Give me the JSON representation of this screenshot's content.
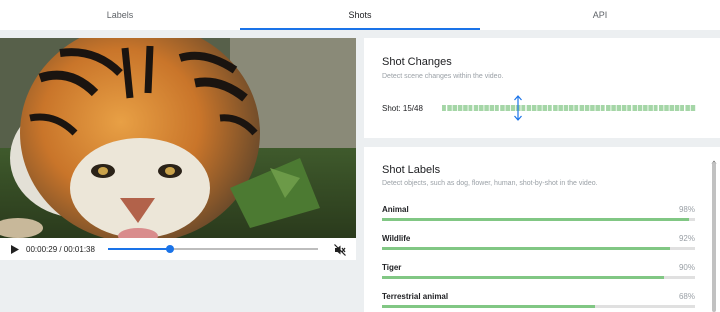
{
  "tabs": [
    {
      "label": "Labels",
      "active": false
    },
    {
      "label": "Shots",
      "active": true
    },
    {
      "label": "API",
      "active": false
    }
  ],
  "player": {
    "time": "00:00:29 / 00:01:38",
    "progress_fraction": 0.296,
    "play_icon": "play-icon",
    "mute_icon": "volume-off-icon"
  },
  "shot_changes": {
    "title": "Shot Changes",
    "subtitle": "Detect scene changes within the video.",
    "shot_label": "Shot: 15/48",
    "current_shot": 15,
    "total_shots": 48
  },
  "shot_labels": {
    "title": "Shot Labels",
    "subtitle": "Detect objects, such as dog, flower, human, shot-by-shot in the video.",
    "items": [
      {
        "name": "Animal",
        "percent": "98%",
        "value": 0.98
      },
      {
        "name": "Wildlife",
        "percent": "92%",
        "value": 0.92
      },
      {
        "name": "Tiger",
        "percent": "90%",
        "value": 0.9
      },
      {
        "name": "Terrestrial animal",
        "percent": "68%",
        "value": 0.68
      }
    ]
  },
  "colors": {
    "accent": "#1a73e8",
    "bar_green": "#81c784",
    "shot_segment": "#a5d6a7"
  }
}
